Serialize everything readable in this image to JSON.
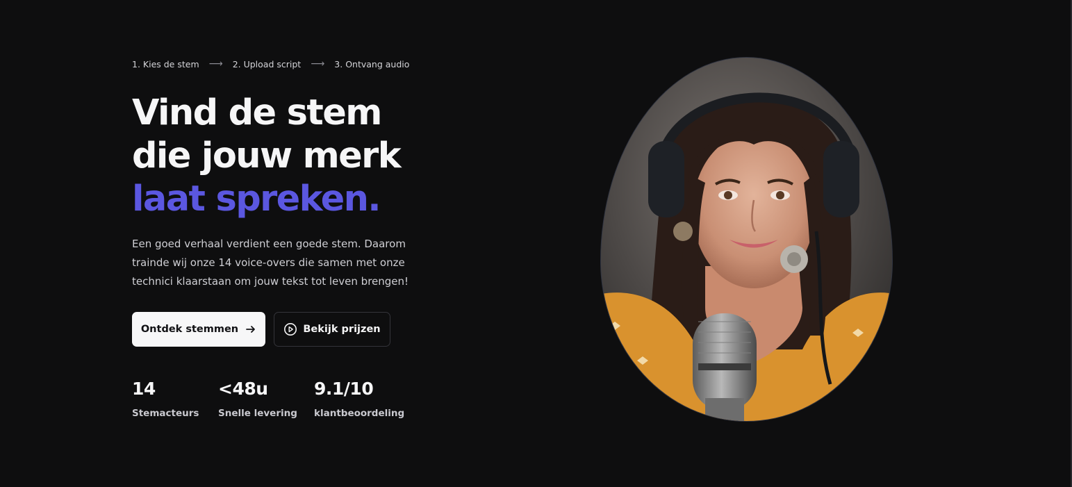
{
  "steps": [
    {
      "label": "1. Kies de stem"
    },
    {
      "label": "2. Upload script"
    },
    {
      "label": "3. Ontvang audio"
    }
  ],
  "step_arrow": "⟶",
  "headline": {
    "line1": "Vind de stem",
    "line2": "die jouw merk",
    "line3": "laat spreken."
  },
  "lead": {
    "line1": "Een goed verhaal verdient een goede stem. Daarom",
    "line2": "trainde wij onze 14 voice-overs die samen met onze",
    "line3": "technici klaarstaan om jouw tekst tot leven brengen!"
  },
  "buttons": {
    "primary_label": "Ontdek stemmen",
    "secondary_label": "Bekijk prijzen"
  },
  "stats": [
    {
      "value": "14",
      "label": "Stemacteurs"
    },
    {
      "value": "<48u",
      "label": "Snelle levering"
    },
    {
      "value": "9.1/10",
      "label": "klantbeoordeling"
    }
  ],
  "colors": {
    "background": "#0e0e0f",
    "accent": "#5b57e0",
    "primary_button": "#f7f7f8"
  },
  "portrait": {
    "alt": "voice-actress-with-headphones-and-microphone"
  }
}
